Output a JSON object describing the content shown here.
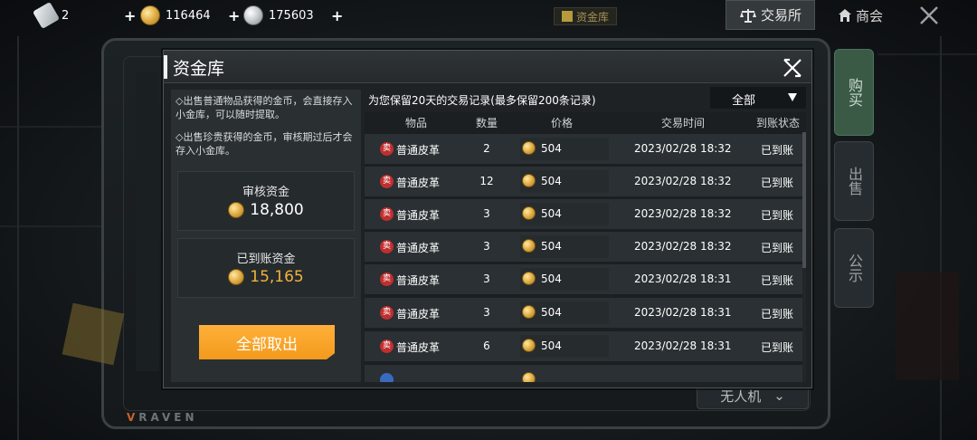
{
  "topbar": {
    "resources": [
      {
        "icon": "ticket-icon",
        "value": "2"
      },
      {
        "icon": "gold-coin-icon",
        "value": "116464"
      },
      {
        "icon": "silver-coin-icon",
        "value": "175603"
      }
    ],
    "vault_hint": "资金库",
    "exchange_label": "交易所",
    "shop_label": "商会"
  },
  "background": {
    "tabs": [
      "购买",
      "出售",
      "公示"
    ],
    "drone_filter": "无人机",
    "brand": "RAVEN"
  },
  "dialog": {
    "title": "资金库",
    "notes": [
      "出售普通物品获得的金币，会直接存入小金库，可以随时提取。",
      "出售珍贵获得的金币，审核期过后才会存入小金库。"
    ],
    "review_funds": {
      "label": "审核资金",
      "value": "18,800"
    },
    "arrived_funds": {
      "label": "已到账资金",
      "value": "15,165"
    },
    "withdraw_label": "全部取出",
    "records_title": "为您保留20天的交易记录(最多保留200条记录)",
    "filter": {
      "selected": "全部"
    },
    "table": {
      "headers": [
        "物品",
        "数量",
        "价格",
        "交易时间",
        "到账状态"
      ],
      "sell_badge": "卖",
      "rows": [
        {
          "item": "普通皮革",
          "qty": "2",
          "price": "504",
          "time": "2023/02/28  18:32",
          "status": "已到账"
        },
        {
          "item": "普通皮革",
          "qty": "12",
          "price": "504",
          "time": "2023/02/28  18:32",
          "status": "已到账"
        },
        {
          "item": "普通皮革",
          "qty": "3",
          "price": "504",
          "time": "2023/02/28  18:32",
          "status": "已到账"
        },
        {
          "item": "普通皮革",
          "qty": "3",
          "price": "504",
          "time": "2023/02/28  18:32",
          "status": "已到账"
        },
        {
          "item": "普通皮革",
          "qty": "3",
          "price": "504",
          "time": "2023/02/28  18:31",
          "status": "已到账"
        },
        {
          "item": "普通皮革",
          "qty": "3",
          "price": "504",
          "time": "2023/02/28  18:31",
          "status": "已到账"
        },
        {
          "item": "普通皮革",
          "qty": "6",
          "price": "504",
          "time": "2023/02/28  18:31",
          "status": "已到账"
        }
      ]
    }
  },
  "colors": {
    "accent_orange": "#f29a1c",
    "gold_text": "#f2b23a",
    "sell_badge": "#c02f2f",
    "active_tab": "#3a5a46"
  }
}
